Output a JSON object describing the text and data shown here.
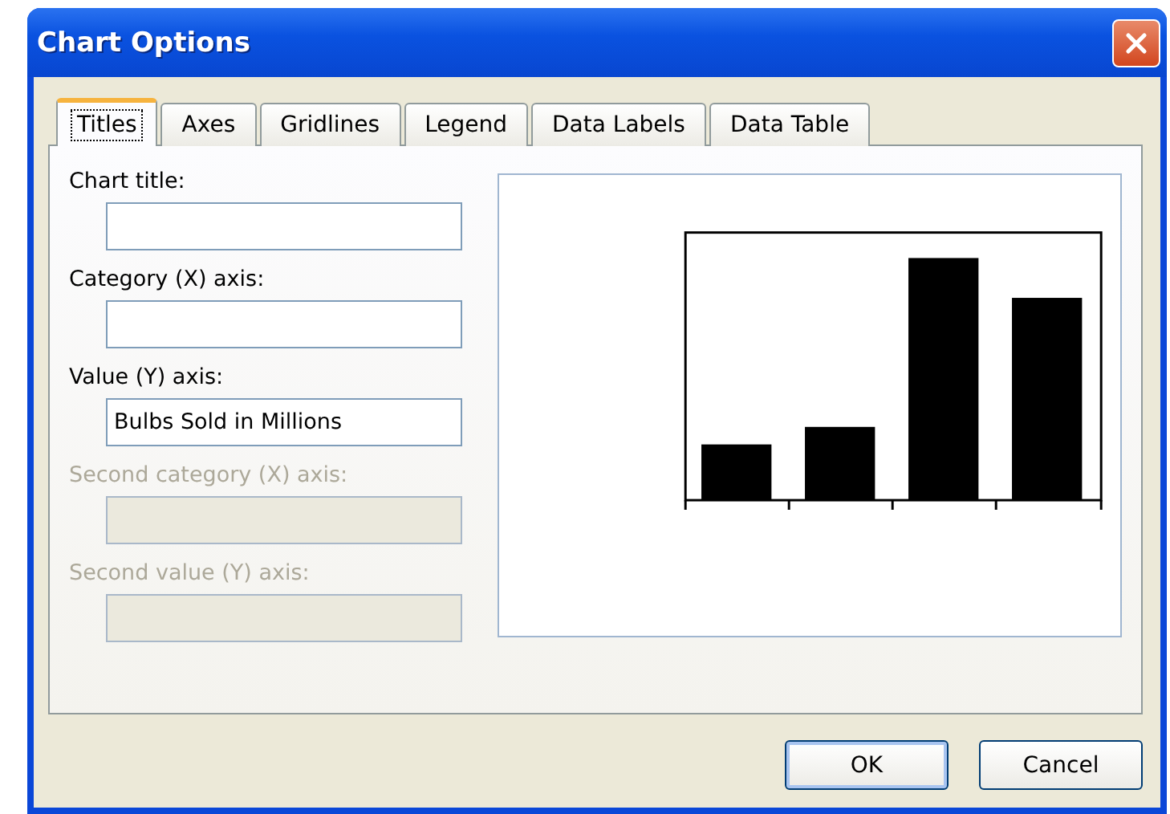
{
  "window": {
    "title": "Chart Options"
  },
  "tabs": [
    {
      "label": "Titles",
      "selected": true
    },
    {
      "label": "Axes",
      "selected": false
    },
    {
      "label": "Gridlines",
      "selected": false
    },
    {
      "label": "Legend",
      "selected": false
    },
    {
      "label": "Data Labels",
      "selected": false
    },
    {
      "label": "Data Table",
      "selected": false
    }
  ],
  "fields": [
    {
      "label": "Chart title:",
      "disabled": false
    },
    {
      "label": "Category (X) axis:",
      "disabled": false
    },
    {
      "label": "Value (Y) axis:",
      "value": "Bulbs Sold in Millions",
      "disabled": false
    },
    {
      "label": "Second category (X) axis:",
      "disabled": true
    },
    {
      "label": "Second value (Y) axis:",
      "disabled": true
    }
  ],
  "buttons": [
    {
      "label": "OK",
      "default": true
    },
    {
      "label": "Cancel",
      "default": false
    }
  ]
}
